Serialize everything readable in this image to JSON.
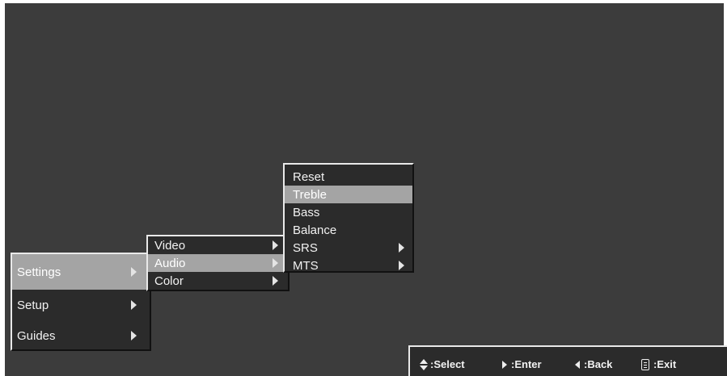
{
  "main_menu": {
    "items": [
      {
        "label": "Settings",
        "selected": true,
        "has_submenu": true
      },
      {
        "label": "Setup",
        "selected": false,
        "has_submenu": true
      },
      {
        "label": "Guides",
        "selected": false,
        "has_submenu": true
      }
    ]
  },
  "settings_menu": {
    "items": [
      {
        "label": "Video",
        "selected": false,
        "has_submenu": true
      },
      {
        "label": "Audio",
        "selected": true,
        "has_submenu": true
      },
      {
        "label": "Color",
        "selected": false,
        "has_submenu": true
      }
    ]
  },
  "audio_menu": {
    "items": [
      {
        "label": "Reset",
        "selected": false
      },
      {
        "label": "Treble",
        "selected": true
      },
      {
        "label": "Bass",
        "selected": false
      },
      {
        "label": "Balance",
        "selected": false
      },
      {
        "label": "SRS",
        "selected": false,
        "has_submenu": true
      },
      {
        "label": "MTS",
        "selected": false,
        "has_submenu": true
      }
    ]
  },
  "footer": {
    "select_label": ":Select",
    "enter_label": ":Enter",
    "back_label": ":Back",
    "exit_label": ":Exit",
    "icons": [
      "up-down-icon",
      "right-arrow-icon",
      "left-arrow-icon",
      "remote-icon"
    ]
  },
  "colors": {
    "background": "#3c3c3c",
    "menu_bg": "#2b2b2b",
    "selected_bg": "#a4a4a4",
    "text": "#f2f2f2"
  }
}
